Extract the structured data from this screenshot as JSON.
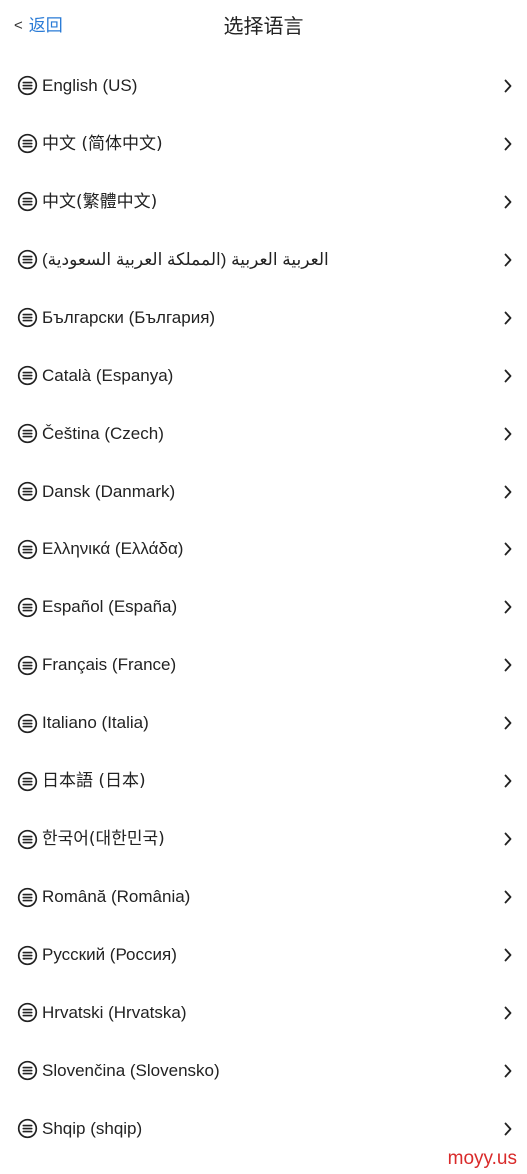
{
  "header": {
    "back_chevron": "<",
    "back_label": "返回",
    "title": "选择语言"
  },
  "icons": {
    "item_icon": "message-lines-icon",
    "trailing_icon": "chevron-right-icon"
  },
  "colors": {
    "link": "#2a7bd6",
    "text": "#222222",
    "watermark": "#d92a2a"
  },
  "languages": [
    {
      "label": "English (US)"
    },
    {
      "label": "中文 (简体中文)"
    },
    {
      "label": "中文(繁體中文)"
    },
    {
      "label": "العربية العربية (المملكة العربية السعودية)"
    },
    {
      "label": "Български (България)"
    },
    {
      "label": "Català (Espanya)"
    },
    {
      "label": "Čeština (Czech)"
    },
    {
      "label": "Dansk (Danmark)"
    },
    {
      "label": "Ελληνικά (Ελλάδα)"
    },
    {
      "label": "Español (España)"
    },
    {
      "label": "Français (France)"
    },
    {
      "label": "Italiano (Italia)"
    },
    {
      "label": "日本語 (日本)"
    },
    {
      "label": "한국어(대한민국)"
    },
    {
      "label": "Română (România)"
    },
    {
      "label": "Русский (Россия)"
    },
    {
      "label": "Hrvatski (Hrvatska)"
    },
    {
      "label": "Slovenčina (Slovensko)"
    },
    {
      "label": "Shqip (shqip)"
    }
  ],
  "watermark": "moyy.us"
}
